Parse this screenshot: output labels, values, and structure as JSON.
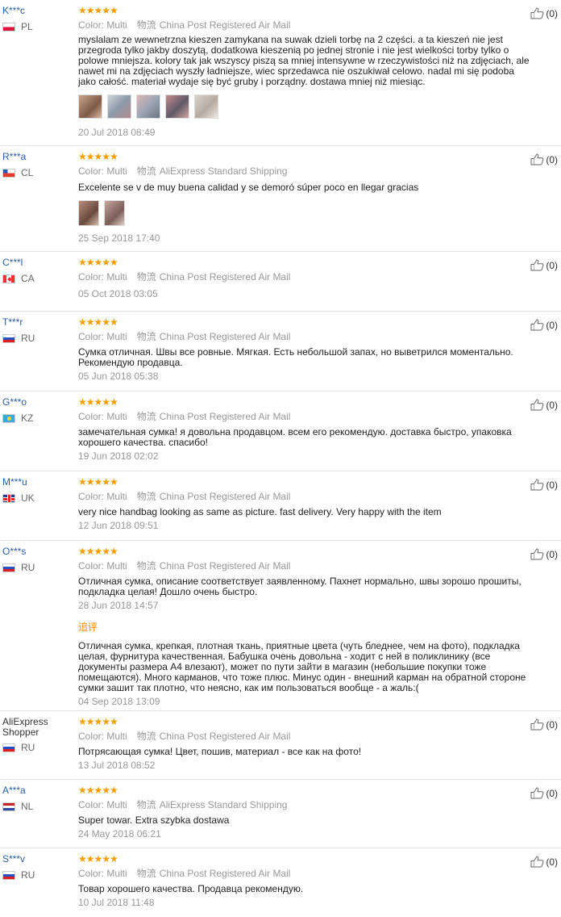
{
  "stars": "★★★★★",
  "color_label": "Color: Multi",
  "shipping_prefix": "物流",
  "additional_label": "追评",
  "reviews": [
    {
      "name": "K***c",
      "country": "PL",
      "color": "Color: Multi",
      "shipping": "China Post Registered Air Mail",
      "text": "myslalam ze wewnetrzna kieszen zamykana na suwak dzieli torbę na 2 części. a ta kieszeń nie jest przegroda tylko jakby doszytą, dodatkowa kieszenią po jednej stronie i nie jest wielkości torby tylko o polowe mniejsza. kolory tak jak wszyscy piszą sa mniej intensywne w rzeczywistości niż na zdjęciach, ale nawet mi na zdjęciach wyszły ładniejsze, wiec sprzedawca nie oszukiwał celowo. nadal mi się podoba jako całość. materiał wydaje się być gruby i porządny. dostawa mniej niż miesiąc.",
      "date": "20 Jul 2018 08:49",
      "helpful": "(0)"
    },
    {
      "name": "R***a",
      "country": "CL",
      "color": "Color: Multi",
      "shipping": "AliExpress Standard Shipping",
      "text": "Excelente se v de muy buena calidad y se demoró súper poco en llegar gracias",
      "date": "25 Sep 2018 17:40",
      "helpful": "(0)"
    },
    {
      "name": "C***l",
      "country": "CA",
      "color": "Color: Multi",
      "shipping": "China Post Registered Air Mail",
      "text": "",
      "date": "05 Oct 2018 03:05",
      "helpful": "(0)"
    },
    {
      "name": "T***r",
      "country": "RU",
      "color": "Color: Multi",
      "shipping": "China Post Registered Air Mail",
      "text": "Сумка отличная. Швы все ровные. Мягкая. Есть небольшой запах, но выветрился моментально. Рекомендую продавца.",
      "date": "05 Jun 2018 05:38",
      "helpful": "(0)"
    },
    {
      "name": "G***o",
      "country": "KZ",
      "color": "Color: Multi",
      "shipping": "China Post Registered Air Mail",
      "text": "замечательная сумка! я довольна продавцом. всем его рекомендую. доставка быстро, упаковка хорошего качества. спасибо!",
      "date": "19 Jun 2018 02:02",
      "helpful": "(0)"
    },
    {
      "name": "M***u",
      "country": "UK",
      "color": "Color: Multi",
      "shipping": "China Post Registered Air Mail",
      "text": "very nice handbag looking as same as picture. fast delivery. Very happy with the item",
      "date": "12 Jun 2018 09:51",
      "helpful": "(0)"
    },
    {
      "name": "O***s",
      "country": "RU",
      "color": "Color: Multi",
      "shipping": "China Post Registered Air Mail",
      "text": "Отличная сумка, описание соответствует заявленному. Пахнет нормально, швы зорошо прошиты, подкладка целая! Дошло очень быстро.",
      "date": "28 Jun 2018 14:57",
      "additional_text": "Отличная сумка, крепкая, плотная ткань, приятные цвета (чуть бледнее, чем на фото), подкладка целая, фурнитура качественная. Бабушка очень довольна - ходит с ней в поликлинику (все документы размера А4 влезают), может по пути зайти в магазин (небольшие покупки тоже помещаются). Много карманов, что тоже плюс. Минус один - внешний карман на обратной стороне сумки зашит так плотно, что неясно, как им пользоваться вообще - а жаль:(",
      "additional_date": "04 Sep 2018 13:09",
      "helpful": "(0)"
    },
    {
      "name": "AliExpress Shopper",
      "country": "RU",
      "color": "Color: Multi",
      "shipping": "China Post Registered Air Mail",
      "text": "Потрясающая сумка! Цвет, пошив, материал - все как на фото!",
      "date": "13 Jul 2018 08:52",
      "helpful": "(0)"
    },
    {
      "name": "A***a",
      "country": "NL",
      "color": "Color: Multi",
      "shipping": "AliExpress Standard Shipping",
      "text": "Super towar. Extra szybka dostawa",
      "date": "24 May 2018 06:21",
      "helpful": "(0)"
    },
    {
      "name": "S***v",
      "country": "RU",
      "color": "Color: Multi",
      "shipping": "China Post Registered Air Mail",
      "text": "Товар хорошего качества. Продавца рекомендую.",
      "date": "10 Jul 2018 11:48",
      "helpful": "(0)"
    }
  ]
}
